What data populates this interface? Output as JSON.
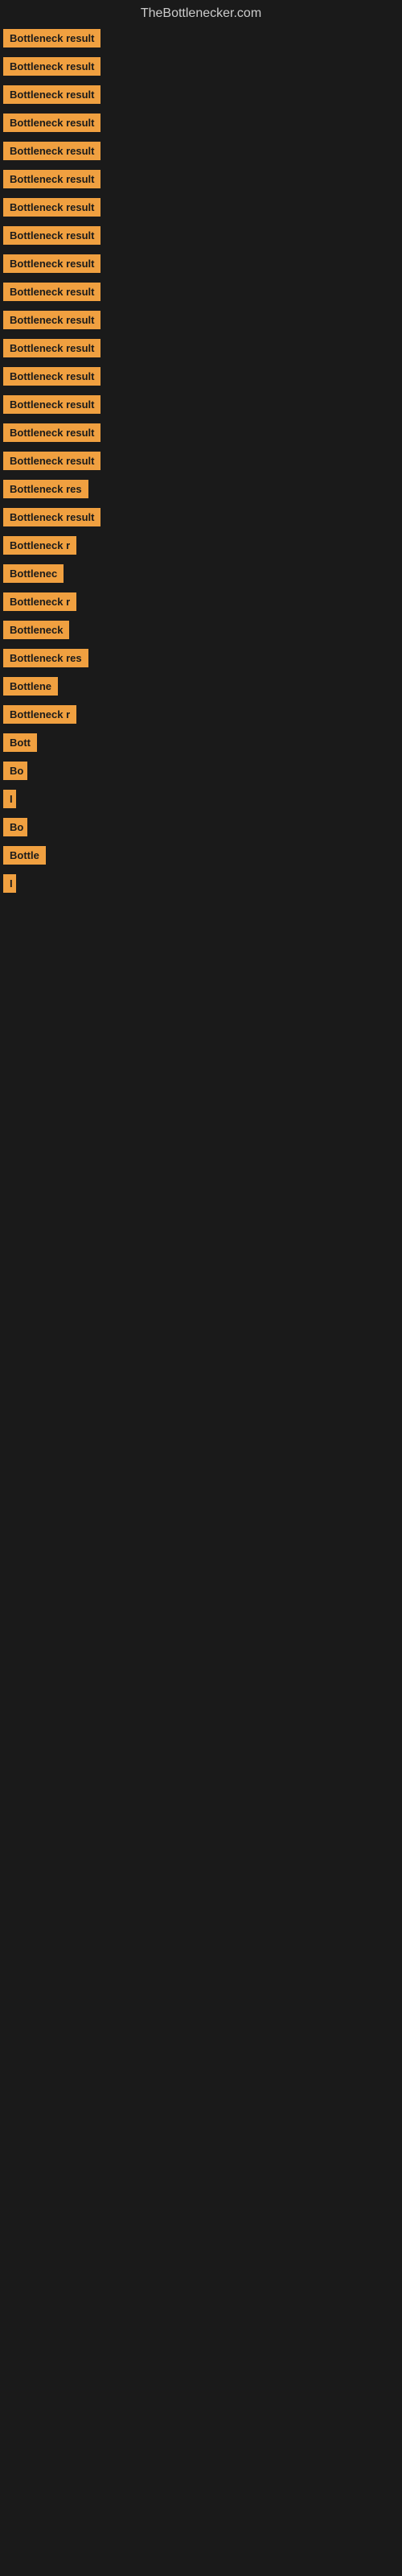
{
  "site_title": "TheBottlenecker.com",
  "items": [
    {
      "label": "Bottleneck result",
      "width": 148
    },
    {
      "label": "Bottleneck result",
      "width": 148
    },
    {
      "label": "Bottleneck result",
      "width": 148
    },
    {
      "label": "Bottleneck result",
      "width": 148
    },
    {
      "label": "Bottleneck result",
      "width": 148
    },
    {
      "label": "Bottleneck result",
      "width": 148
    },
    {
      "label": "Bottleneck result",
      "width": 148
    },
    {
      "label": "Bottleneck result",
      "width": 148
    },
    {
      "label": "Bottleneck result",
      "width": 148
    },
    {
      "label": "Bottleneck result",
      "width": 148
    },
    {
      "label": "Bottleneck result",
      "width": 148
    },
    {
      "label": "Bottleneck result",
      "width": 148
    },
    {
      "label": "Bottleneck result",
      "width": 148
    },
    {
      "label": "Bottleneck result",
      "width": 148
    },
    {
      "label": "Bottleneck result",
      "width": 148
    },
    {
      "label": "Bottleneck result",
      "width": 148
    },
    {
      "label": "Bottleneck res",
      "width": 130
    },
    {
      "label": "Bottleneck result",
      "width": 148
    },
    {
      "label": "Bottleneck r",
      "width": 110
    },
    {
      "label": "Bottlenec",
      "width": 90
    },
    {
      "label": "Bottleneck r",
      "width": 110
    },
    {
      "label": "Bottleneck",
      "width": 95
    },
    {
      "label": "Bottleneck res",
      "width": 130
    },
    {
      "label": "Bottlene",
      "width": 80
    },
    {
      "label": "Bottleneck r",
      "width": 110
    },
    {
      "label": "Bott",
      "width": 50
    },
    {
      "label": "Bo",
      "width": 30
    },
    {
      "label": "I",
      "width": 12
    },
    {
      "label": "Bo",
      "width": 30
    },
    {
      "label": "Bottle",
      "width": 60
    },
    {
      "label": "I",
      "width": 8
    }
  ]
}
